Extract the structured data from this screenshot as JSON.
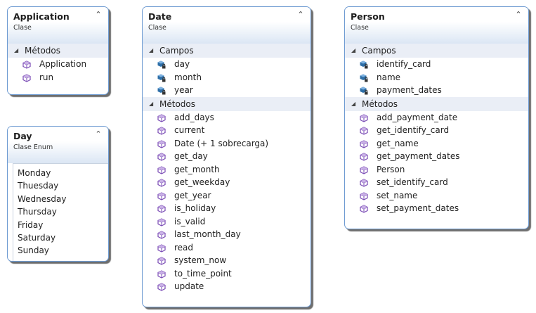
{
  "colors": {
    "border": "#6e9bd2",
    "section_bg": "#eaeef6",
    "method_icon": "#7a4bb5",
    "field_icon": "#2e6fa8"
  },
  "classes": {
    "application": {
      "name": "Application",
      "kind": "Clase",
      "sections": [
        {
          "label": "Métodos",
          "type": "method",
          "items": [
            "Application",
            "run"
          ]
        }
      ]
    },
    "date": {
      "name": "Date",
      "kind": "Clase",
      "sections": [
        {
          "label": "Campos",
          "type": "field",
          "items": [
            "day",
            "month",
            "year"
          ]
        },
        {
          "label": "Métodos",
          "type": "method",
          "items": [
            "add_days",
            "current",
            "Date (+ 1 sobrecarga)",
            "get_day",
            "get_month",
            "get_weekday",
            "get_year",
            "is_holiday",
            "is_valid",
            "last_month_day",
            "read",
            "system_now",
            "to_time_point",
            "update"
          ]
        }
      ]
    },
    "person": {
      "name": "Person",
      "kind": "Clase",
      "sections": [
        {
          "label": "Campos",
          "type": "field",
          "items": [
            "identify_card",
            "name",
            "payment_dates"
          ]
        },
        {
          "label": "Métodos",
          "type": "method",
          "items": [
            "add_payment_date",
            "get_identify_card",
            "get_name",
            "get_payment_dates",
            "Person",
            "set_identify_card",
            "set_name",
            "set_payment_dates"
          ]
        }
      ]
    },
    "day": {
      "name": "Day",
      "kind": "Clase Enum",
      "values": [
        "Monday",
        "Thuesday",
        "Wednesday",
        "Thursday",
        "Friday",
        "Saturday",
        "Sunday"
      ]
    }
  }
}
